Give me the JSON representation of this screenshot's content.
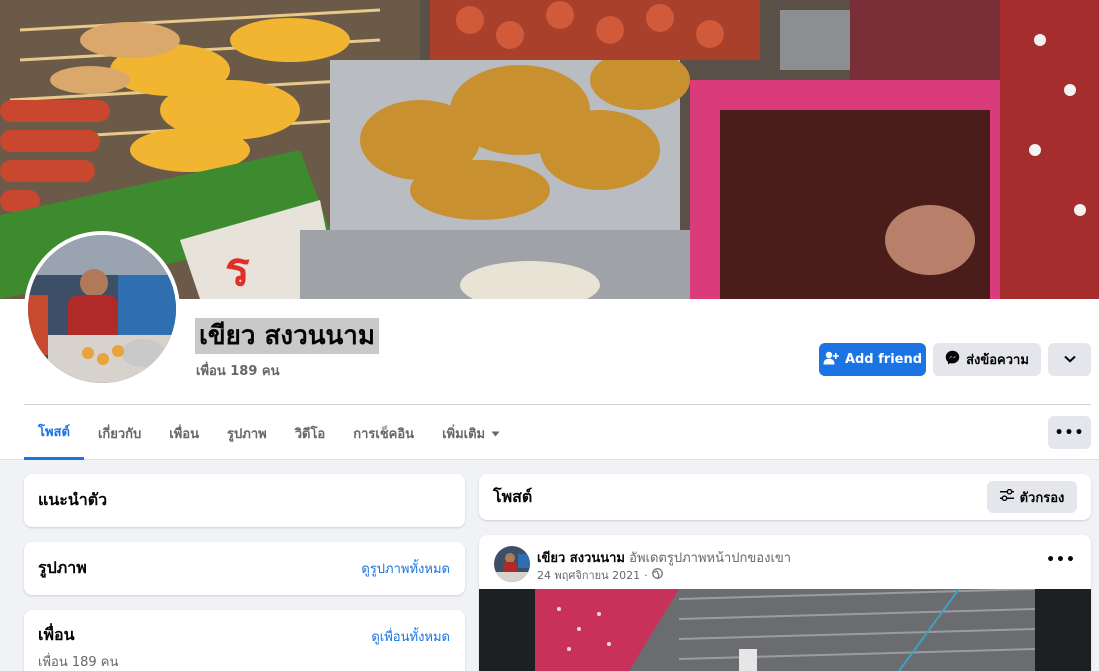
{
  "profile": {
    "name": "เขียว สงวนนาม",
    "friend_count": "เพื่อน 189 คน"
  },
  "actions": {
    "add_friend": "Add friend",
    "message": "ส่งข้อความ"
  },
  "tabs": [
    {
      "label": "โพสต์"
    },
    {
      "label": "เกี่ยวกับ"
    },
    {
      "label": "เพื่อน"
    },
    {
      "label": "รูปภาพ"
    },
    {
      "label": "วิดีโอ"
    },
    {
      "label": "การเช็คอิน"
    },
    {
      "label": "เพิ่มเติม"
    }
  ],
  "left": {
    "intro_title": "แนะนำตัว",
    "photos_title": "รูปภาพ",
    "photos_link": "ดูรูปภาพทั้งหมด",
    "friends_title": "เพื่อน",
    "friends_link": "ดูเพื่อนทั้งหมด",
    "friends_count": "เพื่อน 189 คน"
  },
  "posts": {
    "title": "โพสต์",
    "filter_label": "ตัวกรอง",
    "items": [
      {
        "author": "เขียว สงวนนาม",
        "activity": "อัพเดตรูปภาพหน้าปกของเขา",
        "date": "24 พฤศจิกายน 2021",
        "separator": "·"
      }
    ]
  },
  "colors": {
    "accent": "#1b74e4",
    "page_bg": "#f0f2f5",
    "secondary_button": "#e4e6eb"
  },
  "icons": {
    "add_friend": "add-person-icon",
    "message": "messenger-icon",
    "more": "chevron-down-icon",
    "filter": "sliders-icon",
    "privacy": "globe-icon"
  }
}
